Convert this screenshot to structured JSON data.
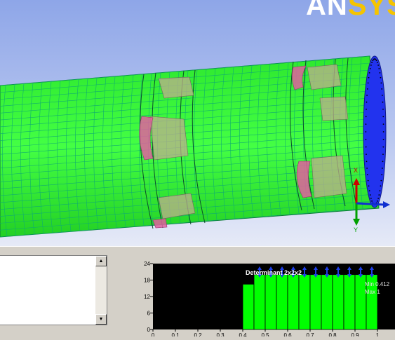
{
  "app": {
    "logo_part1": "AN",
    "logo_part2": "SYS"
  },
  "colors": {
    "mesh_green": "#33ff33",
    "mesh_line": "#00b87a",
    "end_cap": "#2233ee",
    "pink_patch": "#e0609e",
    "histogram_bar": "#00ff00",
    "histogram_bg": "#000000",
    "marker": "#1e3fe8"
  },
  "icons": {
    "scroll_up": "up-arrow-icon",
    "scroll_down": "down-arrow-icon",
    "triad": "axis-triad-icon"
  },
  "triad": {
    "y_label": "Y",
    "x_label": "X"
  },
  "histogram": {
    "title": "Determinant 2x2x2",
    "min_text": "Min 0.412",
    "max_text": "Max 1"
  },
  "chart_data": {
    "type": "bar",
    "title": "Determinant 2x2x2",
    "xlabel": "",
    "ylabel": "",
    "xlim": [
      0,
      1
    ],
    "ylim": [
      0,
      24
    ],
    "yticks": [
      "24",
      "18",
      "12",
      "6",
      "0"
    ],
    "xticks": [
      "0",
      "0.1",
      "0.2",
      "0.3",
      "0.4",
      "0.5",
      "0.6",
      "0.7",
      "0.8",
      "0.9",
      "1"
    ],
    "bins": [
      {
        "x0": 0.4,
        "x1": 0.45,
        "value": 16.5
      },
      {
        "x0": 0.45,
        "x1": 0.5,
        "value": 20
      },
      {
        "x0": 0.5,
        "x1": 0.55,
        "value": 20
      },
      {
        "x0": 0.55,
        "x1": 0.6,
        "value": 20
      },
      {
        "x0": 0.6,
        "x1": 0.65,
        "value": 20
      },
      {
        "x0": 0.65,
        "x1": 0.7,
        "value": 20
      },
      {
        "x0": 0.7,
        "x1": 0.75,
        "value": 20
      },
      {
        "x0": 0.75,
        "x1": 0.8,
        "value": 20
      },
      {
        "x0": 0.8,
        "x1": 0.85,
        "value": 20
      },
      {
        "x0": 0.85,
        "x1": 0.9,
        "value": 20
      },
      {
        "x0": 0.9,
        "x1": 0.95,
        "value": 20
      },
      {
        "x0": 0.95,
        "x1": 1.0,
        "value": 20
      }
    ],
    "markers_x": [
      0.475,
      0.525,
      0.575,
      0.625,
      0.675,
      0.725,
      0.775,
      0.825,
      0.875,
      0.925,
      0.975
    ],
    "grid": false
  }
}
